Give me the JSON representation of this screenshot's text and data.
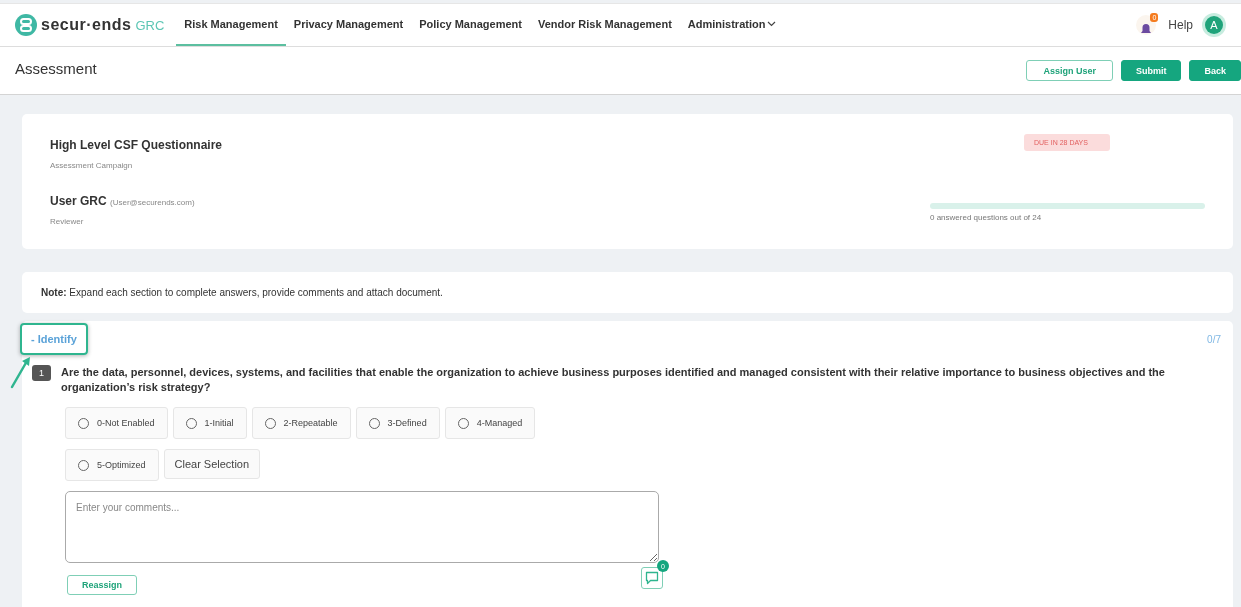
{
  "brand": {
    "name": "secur·ends",
    "suffix": "GRC"
  },
  "nav": [
    {
      "label": "Risk Management",
      "selected": true
    },
    {
      "label": "Privacy Management",
      "selected": false
    },
    {
      "label": "Policy Management",
      "selected": false
    },
    {
      "label": "Vendor Risk Management",
      "selected": false
    },
    {
      "label": "Administration",
      "selected": false,
      "dropdown": true
    }
  ],
  "header": {
    "notification_count": "0",
    "help": "Help",
    "avatar": "A"
  },
  "page": {
    "title": "Assessment",
    "buttons": [
      {
        "label": "Assign User",
        "kind": "outline"
      },
      {
        "label": "Submit",
        "kind": "solid"
      },
      {
        "label": "Back",
        "kind": "solid"
      }
    ]
  },
  "summary": {
    "campaign": "High Level CSF Questionnaire",
    "campaign_label": "Assessment Campaign",
    "user": "User GRC",
    "email": "(User@securends.com)",
    "role": "Reviewer",
    "due": "DUE IN 28 DAYS",
    "progress": {
      "level": 0,
      "caption": "0 answered questions out of 24"
    }
  },
  "note": {
    "label": "Note:",
    "text": "Expand each section to complete answers, provide comments and attach document."
  },
  "section": {
    "title": "- Identify",
    "highlighted": true,
    "count": "0/7",
    "question": {
      "number": "1",
      "text": "Are the data, personnel, devices, systems, and facilities that enable the organization to achieve business purposes identified and managed consistent with their relative importance to business objectives and the organization’s risk strategy?",
      "options": [
        {
          "label": "0-Not Enabled",
          "selected": false
        },
        {
          "label": "1-Initial",
          "selected": false
        },
        {
          "label": "2-Repeatable",
          "selected": false
        },
        {
          "label": "3-Defined",
          "selected": false
        },
        {
          "label": "4-Managed",
          "selected": false
        },
        {
          "label": "5-Optimized",
          "selected": false
        }
      ],
      "clear": "Clear Selection",
      "comment_placeholder": "Enter your comments...",
      "reassign": "Reassign",
      "comment_count": "0"
    }
  }
}
